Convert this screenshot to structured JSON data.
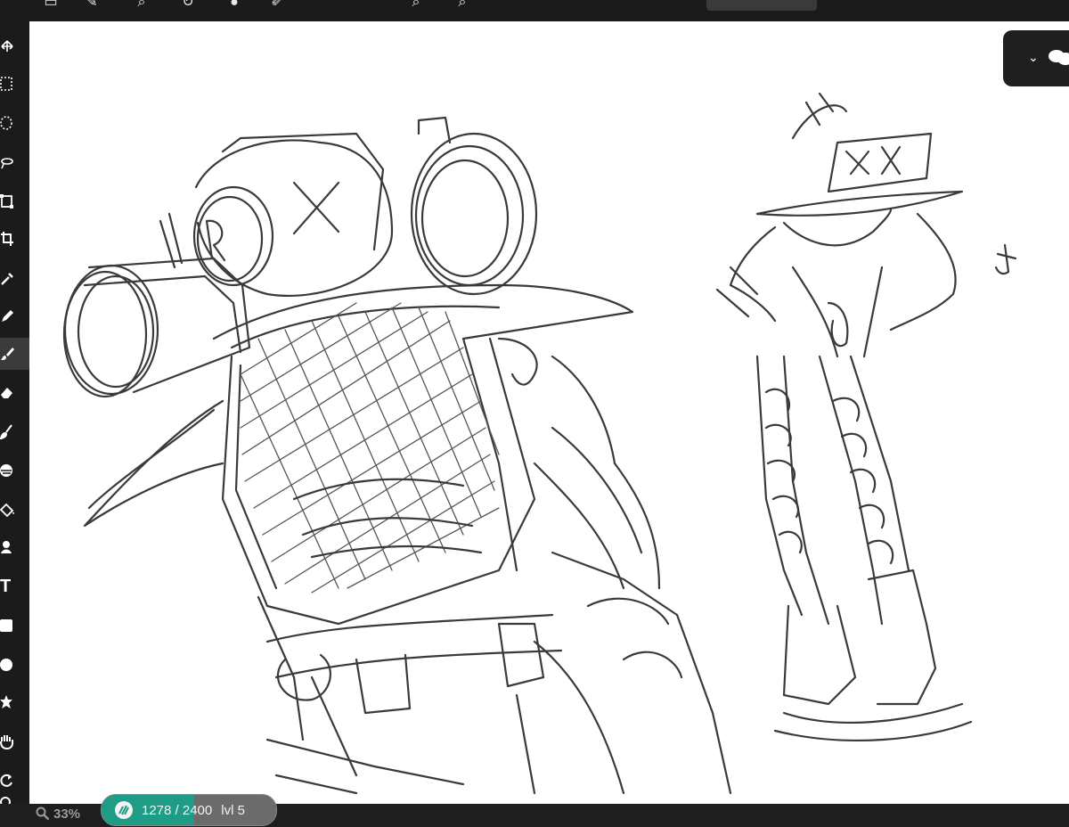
{
  "toolbar": {
    "icons": [
      "file-icon",
      "pen-icon",
      "search-icon",
      "rotate-icon",
      "help-icon",
      "brush-icon",
      "zoom-out-icon",
      "zoom-in-icon"
    ]
  },
  "sidebar": {
    "tools": [
      {
        "name": "move-tool",
        "icon": "move-icon"
      },
      {
        "name": "rect-select-tool",
        "icon": "rect-select-icon"
      },
      {
        "name": "ellipse-select-tool",
        "icon": "ellipse-select-icon"
      },
      {
        "name": "lasso-tool",
        "icon": "lasso-icon"
      },
      {
        "name": "transform-tool",
        "icon": "transform-icon"
      },
      {
        "name": "crop-tool",
        "icon": "crop-icon"
      },
      {
        "name": "eyedropper-tool",
        "icon": "eyedropper-icon"
      },
      {
        "name": "pencil-tool",
        "icon": "pencil-icon"
      },
      {
        "name": "brush-tool",
        "icon": "brush-icon",
        "active": true
      },
      {
        "name": "eraser-tool",
        "icon": "eraser-icon"
      },
      {
        "name": "smudge-tool",
        "icon": "smudge-icon"
      },
      {
        "name": "blur-tool",
        "icon": "blur-icon"
      },
      {
        "name": "fill-tool",
        "icon": "bucket-icon"
      },
      {
        "name": "clone-tool",
        "icon": "clone-icon"
      },
      {
        "name": "text-tool",
        "icon": "text-icon",
        "glyph": "T"
      },
      {
        "name": "rectangle-tool",
        "icon": "rectangle-icon"
      },
      {
        "name": "ellipse-tool",
        "icon": "ellipse-icon"
      },
      {
        "name": "star-tool",
        "icon": "star-icon"
      },
      {
        "name": "hand-tool",
        "icon": "hand-icon"
      },
      {
        "name": "rotate-view-tool",
        "icon": "rotate-icon"
      },
      {
        "name": "zoom-tool",
        "icon": "zoom-icon"
      }
    ]
  },
  "status": {
    "zoom": "33%",
    "strokes": "1278 / 2400",
    "strokes_progress": 0.5325,
    "level": "lvl 5"
  },
  "colors": {
    "chrome": "#1b1b1b",
    "canvas": "#ffffff",
    "accent": "#1f9c86"
  }
}
